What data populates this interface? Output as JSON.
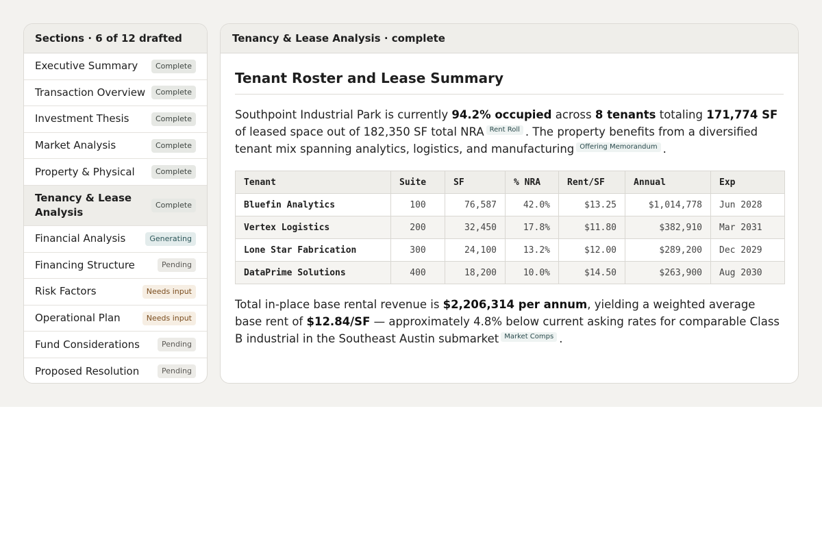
{
  "sidebar": {
    "header": "Sections · 6 of 12 drafted",
    "items": [
      {
        "label": "Executive Summary",
        "status": "Complete",
        "kind": "complete"
      },
      {
        "label": "Transaction Overview",
        "status": "Complete",
        "kind": "complete"
      },
      {
        "label": "Investment Thesis",
        "status": "Complete",
        "kind": "complete"
      },
      {
        "label": "Market Analysis",
        "status": "Complete",
        "kind": "complete"
      },
      {
        "label": "Property & Physical",
        "status": "Complete",
        "kind": "complete"
      },
      {
        "label": "Tenancy & Lease Analysis",
        "status": "Complete",
        "kind": "complete",
        "active": true
      },
      {
        "label": "Financial Analysis",
        "status": "Generating",
        "kind": "generating"
      },
      {
        "label": "Financing Structure",
        "status": "Pending",
        "kind": "pending"
      },
      {
        "label": "Risk Factors",
        "status": "Needs input",
        "kind": "needs"
      },
      {
        "label": "Operational Plan",
        "status": "Needs input",
        "kind": "needs"
      },
      {
        "label": "Fund Considerations",
        "status": "Pending",
        "kind": "pending"
      },
      {
        "label": "Proposed Resolution",
        "status": "Pending",
        "kind": "pending"
      }
    ]
  },
  "main": {
    "header": "Tenancy & Lease Analysis · complete",
    "title": "Tenant Roster and Lease Summary",
    "para1": {
      "t1": "Southpoint Industrial Park is currently ",
      "b1": "94.2% occupied",
      "t2": " across ",
      "b2": "8 tenants",
      "t3": " totaling ",
      "b3": "171,774 SF",
      "t4": " of leased space out of 182,350 SF total NRA",
      "cite1": "Rent Roll",
      "t5": ". The property benefits from a diversified tenant mix spanning analytics, logistics, and manufacturing",
      "cite2": "Offering Memorandum",
      "t6": "."
    },
    "table": {
      "headers": [
        "Tenant",
        "Suite",
        "SF",
        "% NRA",
        "Rent/SF",
        "Annual",
        "Exp"
      ],
      "rows": [
        [
          "Bluefin Analytics",
          "100",
          "76,587",
          "42.0%",
          "$13.25",
          "$1,014,778",
          "Jun 2028"
        ],
        [
          "Vertex Logistics",
          "200",
          "32,450",
          "17.8%",
          "$11.80",
          "$382,910",
          "Mar 2031"
        ],
        [
          "Lone Star Fabrication",
          "300",
          "24,100",
          "13.2%",
          "$12.00",
          "$289,200",
          "Dec 2029"
        ],
        [
          "DataPrime Solutions",
          "400",
          "18,200",
          "10.0%",
          "$14.50",
          "$263,900",
          "Aug 2030"
        ]
      ]
    },
    "para2": {
      "t1": "Total in-place base rental revenue is ",
      "b1": "$2,206,314 per annum",
      "t2": ", yielding a weighted average base rent of ",
      "b2": "$12.84/SF",
      "t3": " — approximately 4.8% below current asking rates for comparable Class B industrial in the Southeast Austin submarket",
      "cite1": "Market Comps",
      "t4": "."
    }
  }
}
